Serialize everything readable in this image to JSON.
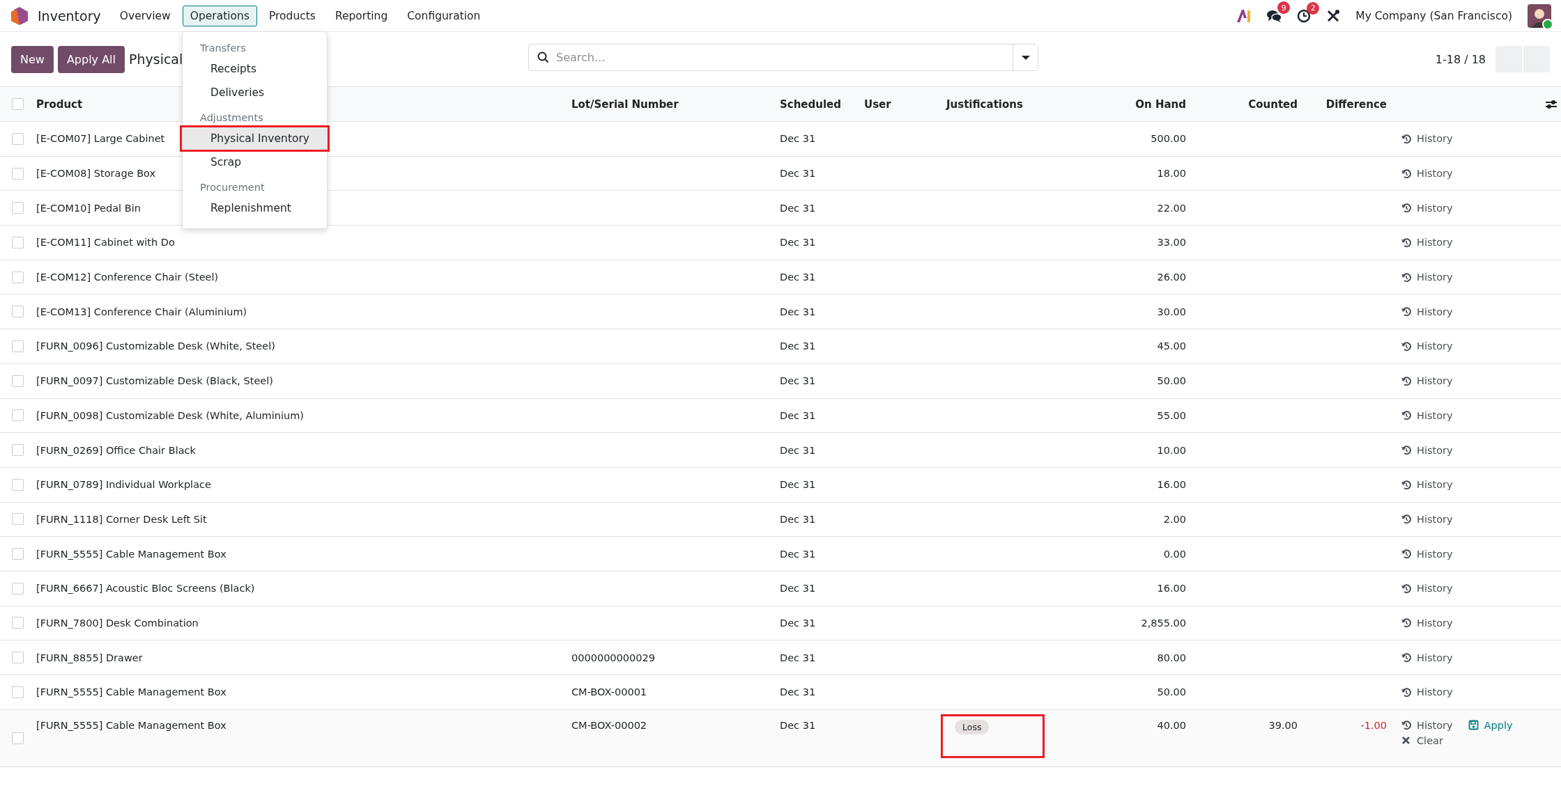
{
  "app": {
    "name": "Inventory"
  },
  "nav": [
    {
      "label": "Overview",
      "selected": false
    },
    {
      "label": "Operations",
      "selected": true
    },
    {
      "label": "Products",
      "selected": false
    },
    {
      "label": "Reporting",
      "selected": false
    },
    {
      "label": "Configuration",
      "selected": false
    }
  ],
  "systray": {
    "chat_count": "9",
    "activity_count": "2",
    "company": "My Company (San Francisco)",
    "user_online": true
  },
  "control_panel": {
    "buttons": [
      "New",
      "Apply All"
    ],
    "title": "Physical",
    "search": {
      "placeholder": "Search..."
    },
    "pager": "1-18 / 18"
  },
  "menu": [
    {
      "header": "Transfers",
      "items": [
        {
          "label": "Receipts",
          "selected": false,
          "highlighted": false
        },
        {
          "label": "Deliveries",
          "selected": false,
          "highlighted": false
        }
      ]
    },
    {
      "header": "Adjustments",
      "items": [
        {
          "label": "Physical Inventory",
          "selected": true,
          "highlighted": true
        },
        {
          "label": "Scrap",
          "selected": false,
          "highlighted": false
        }
      ]
    },
    {
      "header": "Procurement",
      "items": [
        {
          "label": "Replenishment",
          "selected": false,
          "highlighted": false
        }
      ]
    }
  ],
  "table": {
    "select_all_checked": false,
    "columns": [
      "Product",
      "Lot/Serial Number",
      "Scheduled",
      "User",
      "Justifications",
      "On Hand",
      "Counted",
      "Difference"
    ],
    "rows": [
      {
        "checked": false,
        "product": "[E-COM07] Large Cabinet",
        "scheduled": "Dec 31",
        "on_hand": "500.00",
        "actions": [
          {
            "kind": "history",
            "label": "History"
          }
        ]
      },
      {
        "checked": false,
        "product": "[E-COM08] Storage Box",
        "scheduled": "Dec 31",
        "on_hand": "18.00",
        "actions": [
          {
            "kind": "history",
            "label": "History"
          }
        ]
      },
      {
        "checked": false,
        "product": "[E-COM10] Pedal Bin",
        "scheduled": "Dec 31",
        "on_hand": "22.00",
        "actions": [
          {
            "kind": "history",
            "label": "History"
          }
        ]
      },
      {
        "checked": false,
        "product": "[E-COM11] Cabinet with Do",
        "scheduled": "Dec 31",
        "on_hand": "33.00",
        "actions": [
          {
            "kind": "history",
            "label": "History"
          }
        ]
      },
      {
        "checked": false,
        "product": "[E-COM12] Conference Chair (Steel)",
        "scheduled": "Dec 31",
        "on_hand": "26.00",
        "actions": [
          {
            "kind": "history",
            "label": "History"
          }
        ]
      },
      {
        "checked": false,
        "product": "[E-COM13] Conference Chair (Aluminium)",
        "scheduled": "Dec 31",
        "on_hand": "30.00",
        "actions": [
          {
            "kind": "history",
            "label": "History"
          }
        ]
      },
      {
        "checked": false,
        "product": "[FURN_0096] Customizable Desk (White, Steel)",
        "scheduled": "Dec 31",
        "on_hand": "45.00",
        "actions": [
          {
            "kind": "history",
            "label": "History"
          }
        ]
      },
      {
        "checked": false,
        "product": "[FURN_0097] Customizable Desk (Black, Steel)",
        "scheduled": "Dec 31",
        "on_hand": "50.00",
        "actions": [
          {
            "kind": "history",
            "label": "History"
          }
        ]
      },
      {
        "checked": false,
        "product": "[FURN_0098] Customizable Desk (White, Aluminium)",
        "scheduled": "Dec 31",
        "on_hand": "55.00",
        "actions": [
          {
            "kind": "history",
            "label": "History"
          }
        ]
      },
      {
        "checked": false,
        "product": "[FURN_0269] Office Chair Black",
        "scheduled": "Dec 31",
        "on_hand": "10.00",
        "actions": [
          {
            "kind": "history",
            "label": "History"
          }
        ]
      },
      {
        "checked": false,
        "product": "[FURN_0789] Individual Workplace",
        "scheduled": "Dec 31",
        "on_hand": "16.00",
        "actions": [
          {
            "kind": "history",
            "label": "History"
          }
        ]
      },
      {
        "checked": false,
        "product": "[FURN_1118] Corner Desk Left Sit",
        "scheduled": "Dec 31",
        "on_hand": "2.00",
        "actions": [
          {
            "kind": "history",
            "label": "History"
          }
        ]
      },
      {
        "checked": false,
        "product": "[FURN_5555] Cable Management Box",
        "scheduled": "Dec 31",
        "on_hand": "0.00",
        "actions": [
          {
            "kind": "history",
            "label": "History"
          }
        ]
      },
      {
        "checked": false,
        "product": "[FURN_6667] Acoustic Bloc Screens (Black)",
        "scheduled": "Dec 31",
        "on_hand": "16.00",
        "actions": [
          {
            "kind": "history",
            "label": "History"
          }
        ]
      },
      {
        "checked": false,
        "product": "[FURN_7800] Desk Combination",
        "scheduled": "Dec 31",
        "on_hand": "2,855.00",
        "actions": [
          {
            "kind": "history",
            "label": "History"
          }
        ]
      },
      {
        "checked": false,
        "product": "[FURN_8855] Drawer",
        "lot": "0000000000029",
        "scheduled": "Dec 31",
        "on_hand": "80.00",
        "actions": [
          {
            "kind": "history",
            "label": "History"
          }
        ]
      },
      {
        "checked": false,
        "product": "[FURN_5555] Cable Management Box",
        "lot": "CM-BOX-00001",
        "scheduled": "Dec 31",
        "on_hand": "50.00",
        "actions": [
          {
            "kind": "history",
            "label": "History"
          }
        ]
      },
      {
        "checked": false,
        "product": "[FURN_5555] Cable Management Box",
        "lot": "CM-BOX-00002",
        "scheduled": "Dec 31",
        "justification": "Loss",
        "justification_highlighted": true,
        "on_hand": "40.00",
        "counted": "39.00",
        "difference": "-1.00",
        "difference_negative": true,
        "actions": [
          {
            "kind": "history",
            "label": "History"
          },
          {
            "kind": "apply",
            "label": "Apply"
          },
          {
            "kind": "clear",
            "label": "Clear"
          }
        ]
      }
    ]
  }
}
